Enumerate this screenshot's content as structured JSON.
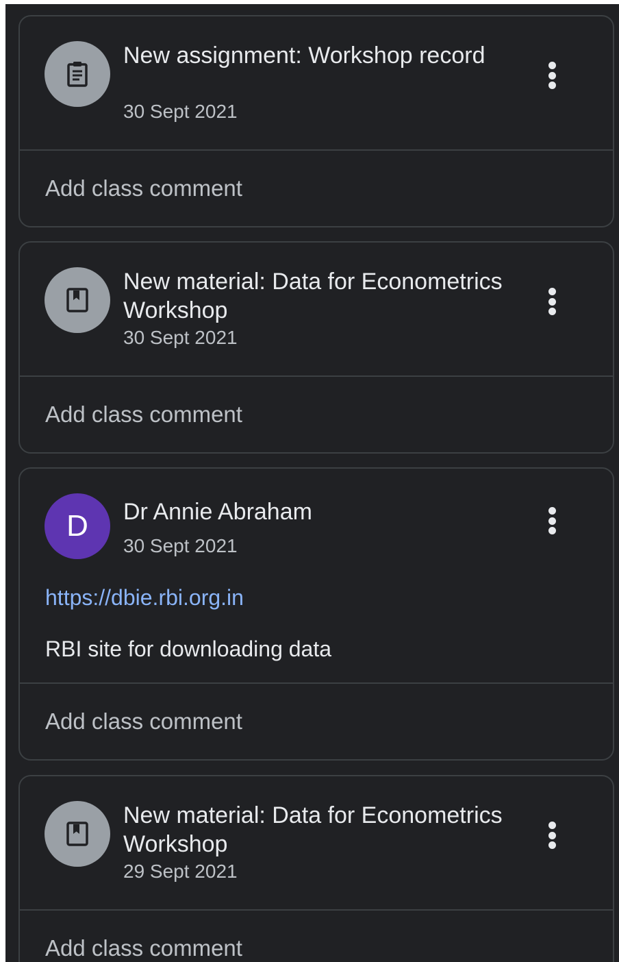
{
  "stream": [
    {
      "icon": "assignment-icon",
      "title": "New assignment: Workshop record",
      "date": "30 Sept 2021",
      "comment_placeholder": "Add class comment"
    },
    {
      "icon": "material-icon",
      "title": "New material: Data for Econometrics Workshop",
      "date": "30 Sept 2021",
      "comment_placeholder": "Add class comment"
    },
    {
      "avatar_letter": "D",
      "author": "Dr Annie Abraham",
      "date": "30 Sept 2021",
      "link": "https://dbie.rbi.org.in",
      "text": "RBI site for downloading data",
      "comment_placeholder": "Add class comment"
    },
    {
      "icon": "material-icon",
      "title": "New material: Data for Econometrics Workshop",
      "date": "29 Sept 2021",
      "comment_placeholder": "Add class comment"
    }
  ],
  "colors": {
    "background": "#202124",
    "card_border": "#3c4043",
    "icon_circle": "#9aa0a6",
    "avatar_purple": "#5e35b1",
    "link": "#8ab4f8"
  }
}
